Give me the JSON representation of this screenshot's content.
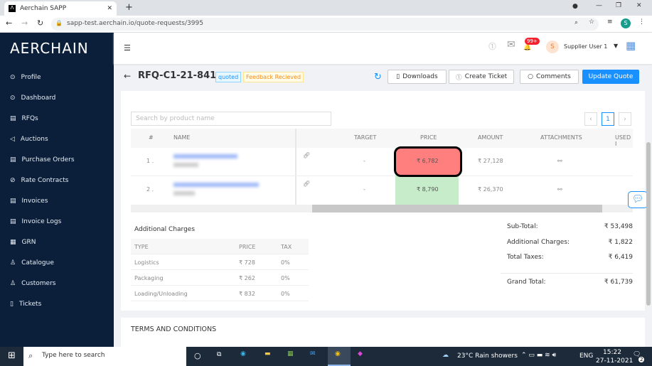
{
  "browser": {
    "tab_title": "Aerchain SAPP",
    "url": "sapp-test.aerchain.io/quote-requests/3995",
    "profile_initial": "S"
  },
  "sidebar": {
    "logo": "AERCHAIN",
    "items": [
      {
        "label": "Profile",
        "icon": "⊙"
      },
      {
        "label": "Dashboard",
        "icon": "⊙"
      },
      {
        "label": "RFQs",
        "icon": "▤"
      },
      {
        "label": "Auctions",
        "icon": "◁"
      },
      {
        "label": "Purchase Orders",
        "icon": "▤"
      },
      {
        "label": "Rate Contracts",
        "icon": "⊘"
      },
      {
        "label": "Invoices",
        "icon": "▤"
      },
      {
        "label": "Invoice Logs",
        "icon": "▤"
      },
      {
        "label": "GRN",
        "icon": "▦"
      },
      {
        "label": "Catalogue",
        "icon": "♙"
      },
      {
        "label": "Customers",
        "icon": "♙"
      },
      {
        "label": "Tickets",
        "icon": "▯"
      }
    ]
  },
  "header": {
    "notif_count": "99+",
    "user_initial": "S",
    "user_name": "Supplier User 1"
  },
  "title": {
    "rfq": "RFQ-C1-21-841",
    "status": "quoted",
    "feedback": "Feedback Recieved",
    "downloads": "Downloads",
    "create_ticket": "Create Ticket",
    "comments": "Comments",
    "update_quote": "Update Quote"
  },
  "table": {
    "search_placeholder": "Search by product name",
    "page": "1",
    "headers": [
      "#",
      "NAME",
      "TARGET",
      "PRICE",
      "AMOUNT",
      "ATTACHMENTS",
      "USED I"
    ],
    "rows": [
      {
        "n": "1 .",
        "target": "-",
        "price": "₹ 6,782",
        "amount": "₹ 27,128"
      },
      {
        "n": "2 .",
        "target": "-",
        "price": "₹ 8,790",
        "amount": "₹ 26,370"
      }
    ]
  },
  "additional": {
    "title": "Additional Charges",
    "headers": [
      "TYPE",
      "PRICE",
      "TAX"
    ],
    "rows": [
      {
        "type": "Logistics",
        "price": "₹ 728",
        "tax": "0%"
      },
      {
        "type": "Packaging",
        "price": "₹ 262",
        "tax": "0%"
      },
      {
        "type": "Loading/Unloading",
        "price": "₹ 832",
        "tax": "0%"
      }
    ]
  },
  "totals": {
    "sub_label": "Sub-Total:",
    "sub": "₹ 53,498",
    "add_label": "Additional Charges:",
    "add": "₹ 1,822",
    "tax_label": "Total Taxes:",
    "tax": "₹ 6,419",
    "grand_label": "Grand Total:",
    "grand": "₹ 61,739"
  },
  "terms": "TERMS AND CONDITIONS",
  "taskbar": {
    "search": "Type here to search",
    "weather": "23°C  Rain showers",
    "lang": "ENG",
    "time": "15:22",
    "date": "27-11-2021",
    "notif": "2"
  },
  "colors": {
    "sidebar": "#0b1f3a",
    "primary": "#1890ff",
    "price_bad": "#ff7f7f",
    "price_good": "#c6ecc9"
  }
}
